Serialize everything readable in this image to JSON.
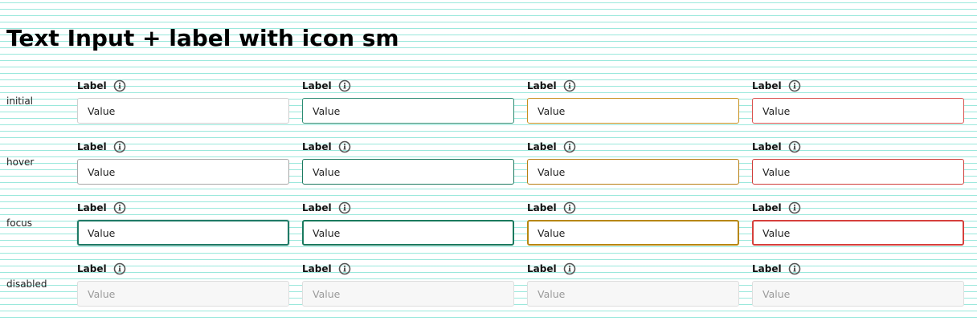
{
  "title": "Text Input + label with icon sm",
  "states": [
    "initial",
    "hover",
    "focus",
    "disabled"
  ],
  "variants": [
    "default",
    "success",
    "warning",
    "error"
  ],
  "field": {
    "label": "Label",
    "value": "Value"
  },
  "icons": {
    "label_icon": "info-icon"
  },
  "colors": {
    "default_border": "#cfcfcf",
    "success_border": "#2c8c72",
    "warning_border": "#c8901f",
    "error_border": "#d9534f",
    "disabled_background": "#f7f7f7",
    "grid_line": "#48d6c0"
  }
}
